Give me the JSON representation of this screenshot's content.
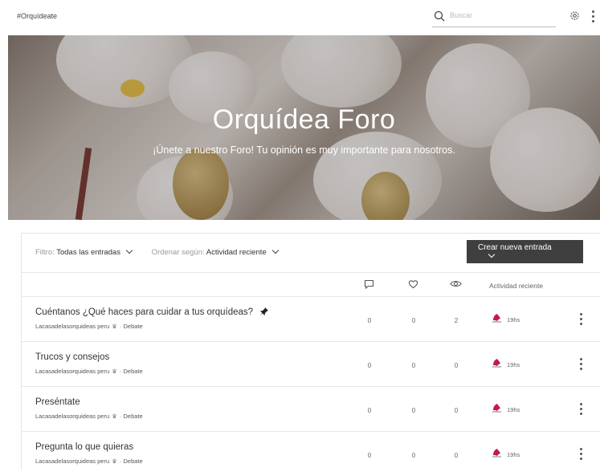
{
  "header": {
    "brand": "#Orquídeate",
    "search_placeholder": "Buscar"
  },
  "hero": {
    "title": "Orquídea Foro",
    "subtitle": "¡Únete a nuestro Foro! Tu opinión es muy importante para nosotros."
  },
  "toolbar": {
    "filter_label": "Filtro:",
    "filter_value": "Todas las entradas",
    "sort_label": "Ordenar según:",
    "sort_value": "Actividad reciente",
    "create_label": "Crear nueva entrada"
  },
  "columns": {
    "activity": "Actividad reciente"
  },
  "posts": [
    {
      "title": "Cuéntanos ¿Qué haces para cuidar a tus orquídeas?",
      "author": "Lacasadelasorquideas peru",
      "category": "Debate",
      "comments": "0",
      "likes": "0",
      "views": "2",
      "time": "19hs",
      "pinned": true
    },
    {
      "title": "Trucos y consejos",
      "author": "Lacasadelasorquideas peru",
      "category": "Debate",
      "comments": "0",
      "likes": "0",
      "views": "0",
      "time": "19hs",
      "pinned": false
    },
    {
      "title": "Preséntate",
      "author": "Lacasadelasorquideas peru",
      "category": "Debate",
      "comments": "0",
      "likes": "0",
      "views": "0",
      "time": "19hs",
      "pinned": false
    },
    {
      "title": "Pregunta lo que quieras",
      "author": "Lacasadelasorquideas peru",
      "category": "Debate",
      "comments": "0",
      "likes": "0",
      "views": "0",
      "time": "19hs",
      "pinned": false
    }
  ],
  "meta_separator": "·",
  "colors": {
    "button_bg": "#3f3f3f",
    "avatar_accent": "#c2185b"
  }
}
